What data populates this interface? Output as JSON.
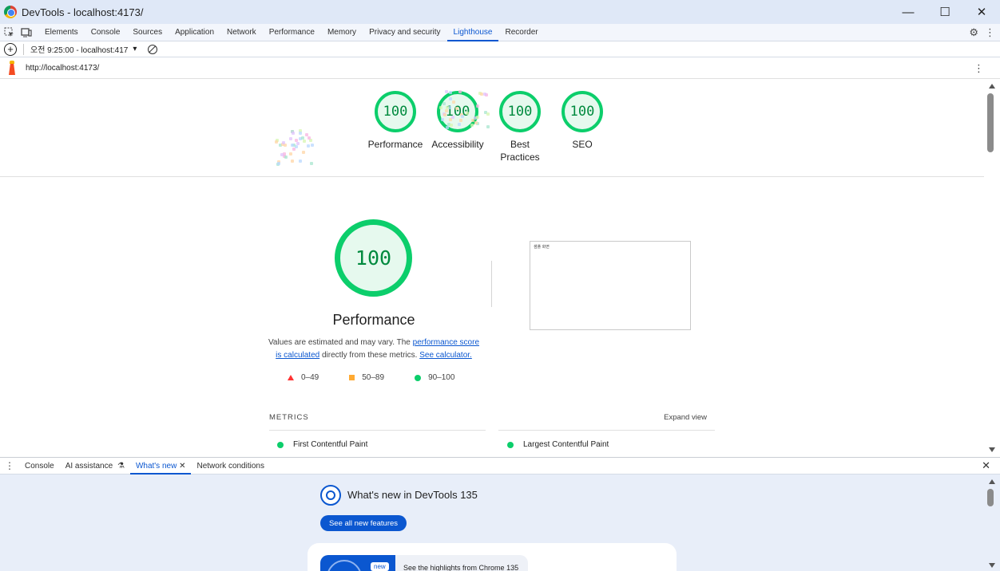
{
  "window": {
    "title": "DevTools - localhost:4173/",
    "controls": [
      "—",
      "☐",
      "✕"
    ]
  },
  "toolbar": {
    "tabs": [
      "Elements",
      "Console",
      "Sources",
      "Application",
      "Network",
      "Performance",
      "Memory",
      "Privacy and security",
      "Lighthouse",
      "Recorder"
    ],
    "active_tab": "Lighthouse"
  },
  "reportbar": {
    "add_label": "+",
    "report_select": "오전 9:25:00 - localhost:417",
    "chevron": "▾"
  },
  "urlbar": {
    "url": "http://localhost:4173/",
    "menu": "⋮"
  },
  "scores": [
    {
      "label": "Performance",
      "value": "100"
    },
    {
      "label": "Accessibility",
      "value": "100"
    },
    {
      "label": "Best Practices",
      "value": "100"
    },
    {
      "label": "SEO",
      "value": "100"
    }
  ],
  "performance": {
    "score": "100",
    "title": "Performance",
    "desc_prefix": "Values are estimated and may vary. The ",
    "desc_link1": "performance score is calculated",
    "desc_middle": " directly from these metrics. ",
    "desc_link2": "See calculator.",
    "legend": [
      {
        "shape": "triangle",
        "range": "0–49",
        "color": "#ff3333"
      },
      {
        "shape": "square",
        "range": "50–89",
        "color": "#ffaa33"
      },
      {
        "shape": "circle",
        "range": "90–100",
        "color": "#0cce6b"
      }
    ],
    "screenshot_text": "샘플 화면"
  },
  "metrics": {
    "header": "METRICS",
    "expand": "Expand view",
    "items": [
      "First Contentful Paint",
      "Largest Contentful Paint"
    ]
  },
  "drawer": {
    "tabs": [
      "Console",
      "AI assistance",
      "What's new",
      "Network conditions"
    ],
    "active_tab": "What's new",
    "ai_badge": "⚗",
    "close_tab": "✕",
    "close_drawer": "✕",
    "whats_new_title": "What's new in DevTools 135",
    "button_label": "See all new features",
    "card_badge": "new",
    "card_text": "See the highlights from Chrome 135"
  },
  "colors": {
    "pass": "#0cce6b",
    "accent": "#0b57d0"
  }
}
